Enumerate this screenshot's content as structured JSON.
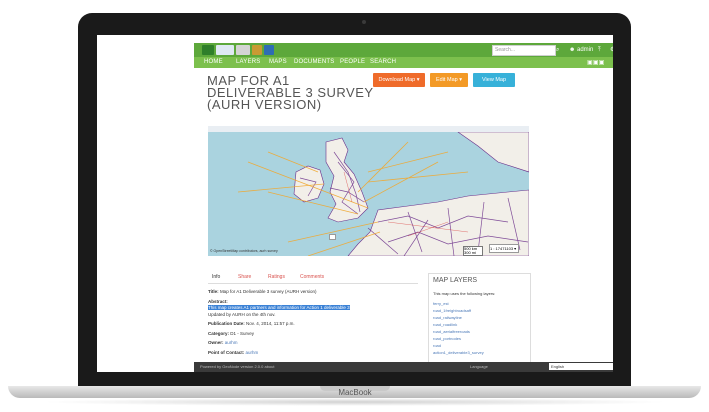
{
  "device": {
    "brand": "MacBook"
  },
  "header": {
    "search_placeholder": "Search...",
    "user_label": "admin"
  },
  "nav": [
    "HOME",
    "LAYERS",
    "MAPS",
    "DOCUMENTS",
    "PEOPLE",
    "SEARCH"
  ],
  "page": {
    "title": "MAP FOR A1 DELIVERABLE 3 SURVEY (AURH VERSION)",
    "buttons": {
      "download": "Download Map",
      "edit": "Edit Map",
      "view": "View Map"
    }
  },
  "map": {
    "credits": "© OpenStreetMap contributors, aurh survey",
    "scale_km": "500 km",
    "scale_mi": "300 mi",
    "scale_value": "1 : 17471103"
  },
  "tabs": [
    "Info",
    "Share",
    "Ratings",
    "Comments"
  ],
  "info": {
    "title_label": "Title:",
    "title_value": "Map for A1 Deliverable 3 survey (AURH version)",
    "abstract_label": "Abstract:",
    "abstract_value": "This map creates A1 partners and information for Action 1 deliverable 3",
    "updated": "Updated by AURH on the 4th nov.",
    "pubdate_label": "Publication Date:",
    "pubdate_value": "Nov. 4, 2014, 11:57 p.m.",
    "category_label": "Category:",
    "category_value": "D1 - Survey",
    "owner_label": "Owner:",
    "owner_value": "aurhm",
    "poc_label": "Point of Contact:",
    "poc_value": "aurhm"
  },
  "layers": {
    "heading": "MAP LAYERS",
    "subtitle": "This map uses the following layers:",
    "items": [
      "ferry_est",
      "road_1freightroadsaff",
      "road_railwayline",
      "road_roadlink",
      "road_aerialfreeroads",
      "road_portnodes",
      "road",
      "action1_deliverable3_survey"
    ]
  },
  "footer": {
    "powered": "Powered by GeoNode  version 2.0.0 about",
    "language_label": "Language",
    "language_value": "English"
  },
  "colors": {
    "green_top": "#5da83b",
    "green_nav": "#7cc04d",
    "download": "#ef6b2a",
    "edit": "#f39a26",
    "view": "#37b1d9",
    "water": "#aad3df",
    "land": "#f2efe9",
    "network": "#6b2f8a"
  }
}
